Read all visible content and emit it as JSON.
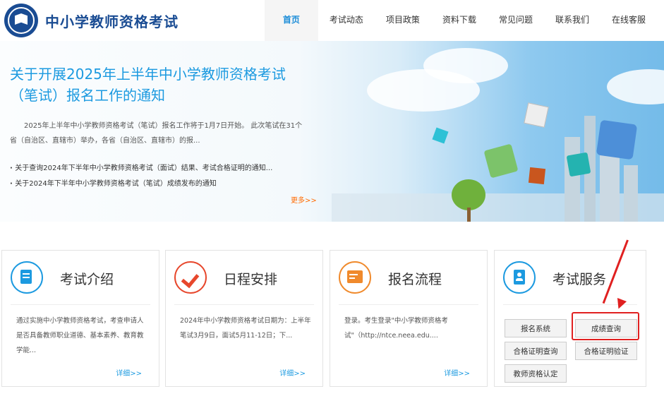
{
  "header": {
    "site_title": "中小学教师资格考试",
    "nav": [
      "首页",
      "考试动态",
      "项目政策",
      "资料下载",
      "常见问题",
      "联系我们",
      "在线客服"
    ],
    "active_nav": "首页"
  },
  "banner": {
    "title": "关于开展2025年上半年中小学教师资格考试（笔试）报名工作的通知",
    "summary": "2025年上半年中小学教师资格考试（笔试）报名工作将于1月7日开始。   此次笔试在31个省（自治区、直辖市）举办，各省（自治区、直辖市）的报...",
    "links": [
      "关于查询2024年下半年中小学教师资格考试（面试）结果、考试合格证明的通知...",
      "关于2024年下半年中小学教师资格考试（笔试）成绩发布的通知"
    ],
    "more_label": "更多>>"
  },
  "cards": [
    {
      "title": "考试介绍",
      "icon": "document-icon",
      "text": "通过实施中小学教师资格考试，考查申请人是否具备教师职业道德、基本素养、教育教学能...",
      "detail": "详细>>"
    },
    {
      "title": "日程安排",
      "icon": "checkmark-icon",
      "text": "2024年中小学教师资格考试日期为：上半年笔试3月9日，面试5月11-12日；下...",
      "detail": "详细>>"
    },
    {
      "title": "报名流程",
      "icon": "registration-icon",
      "text": "登录。考生登录\"中小学教师资格考试\"（http://ntce.neea.edu....",
      "detail": "详细>>"
    },
    {
      "title": "考试服务",
      "icon": "service-book-icon",
      "buttons": [
        "报名系统",
        "成绩查询",
        "合格证明查询",
        "合格证明验证",
        "教师资格认定"
      ]
    }
  ],
  "colors": {
    "brand_blue": "#1a4c93",
    "accent_blue": "#1c9ae0",
    "more_orange": "#ff6a00",
    "highlight_red": "#e02020"
  }
}
